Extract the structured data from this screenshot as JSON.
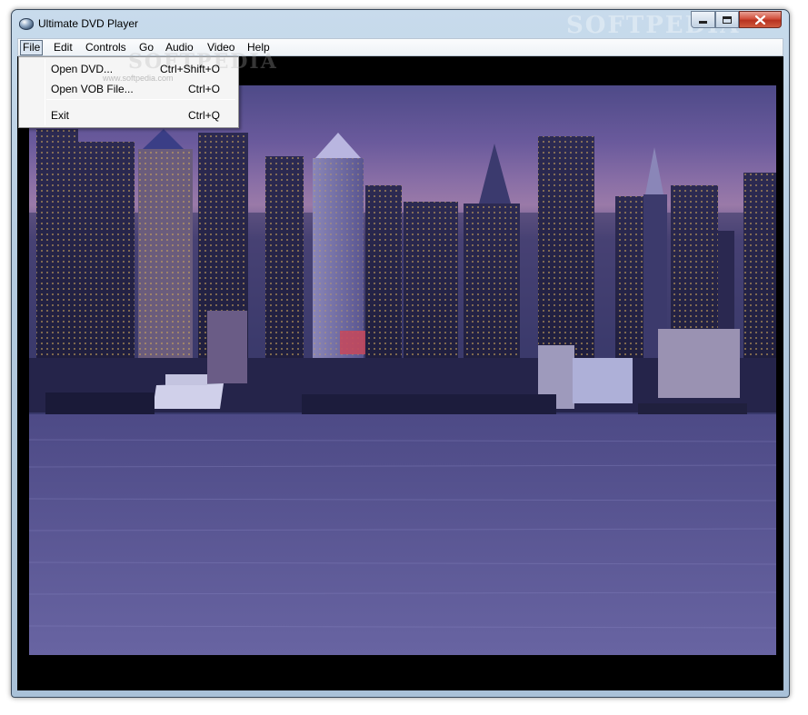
{
  "window": {
    "title": "Ultimate DVD Player",
    "watermark": "SOFTPEDIA"
  },
  "menubar": {
    "items": [
      {
        "label": "File",
        "active": true
      },
      {
        "label": "Edit"
      },
      {
        "label": "Controls"
      },
      {
        "label": "Go"
      },
      {
        "label": "Audio"
      },
      {
        "label": "Video"
      },
      {
        "label": "Help"
      }
    ]
  },
  "file_menu": {
    "items": [
      {
        "label": "Open DVD...",
        "shortcut": "Ctrl+Shift+O"
      },
      {
        "label": "Open VOB File...",
        "shortcut": "Ctrl+O"
      },
      {
        "label": "Exit",
        "shortcut": "Ctrl+Q"
      }
    ],
    "watermark_small": "www.softpedia.com",
    "watermark_big": "SOFTPEDIA"
  },
  "icons": {
    "app": "dvd-disc-icon",
    "minimize": "minimize-icon",
    "maximize": "maximize-icon",
    "close": "close-icon"
  }
}
